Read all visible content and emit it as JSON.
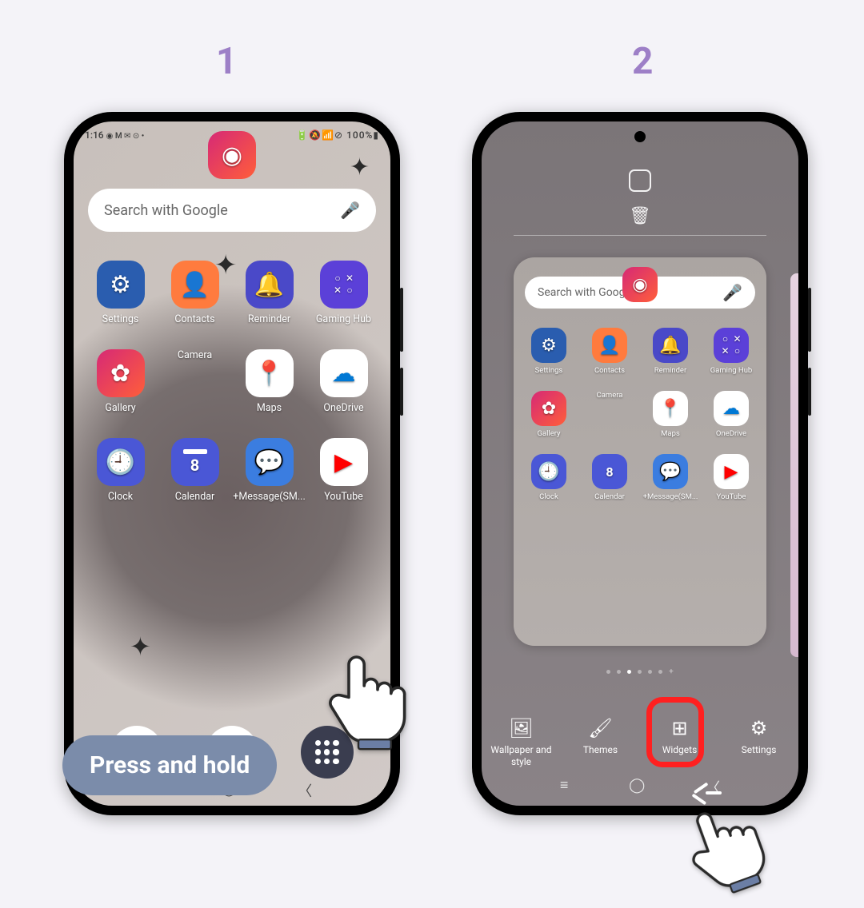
{
  "steps": {
    "one": "1",
    "two": "2"
  },
  "instruction": "Press and hold",
  "status": {
    "time": "1:16",
    "icons_left": "◉ M ✉ ⊙ •",
    "right": "🔋🔕📶⊘ 100%▮"
  },
  "search": {
    "placeholder": "Search with Google"
  },
  "apps": {
    "r1": [
      {
        "label": "Settings",
        "cls": "settings",
        "glyph": "⚙"
      },
      {
        "label": "Contacts",
        "cls": "contacts",
        "glyph": "👤"
      },
      {
        "label": "Reminder",
        "cls": "reminder",
        "glyph": "🔔"
      },
      {
        "label": "Gaming Hub",
        "cls": "gaming",
        "glyph": ""
      }
    ],
    "r2": [
      {
        "label": "Gallery",
        "cls": "gallery",
        "glyph": "✿"
      },
      {
        "label": "Camera",
        "cls": "camera",
        "glyph": "◉"
      },
      {
        "label": "Maps",
        "cls": "maps",
        "glyph": "📍"
      },
      {
        "label": "OneDrive",
        "cls": "onedrive",
        "glyph": "☁"
      }
    ],
    "r3": [
      {
        "label": "Clock",
        "cls": "clock",
        "glyph": "🕘"
      },
      {
        "label": "Calendar",
        "cls": "calendar",
        "glyph": "8"
      },
      {
        "label": "+Message(SM...",
        "cls": "message",
        "glyph": "💬"
      },
      {
        "label": "YouTube",
        "cls": "youtube",
        "glyph": "▶"
      }
    ]
  },
  "editbar": {
    "wallpaper": "Wallpaper and style",
    "themes": "Themes",
    "widgets": "Widgets",
    "settings": "Settings"
  }
}
